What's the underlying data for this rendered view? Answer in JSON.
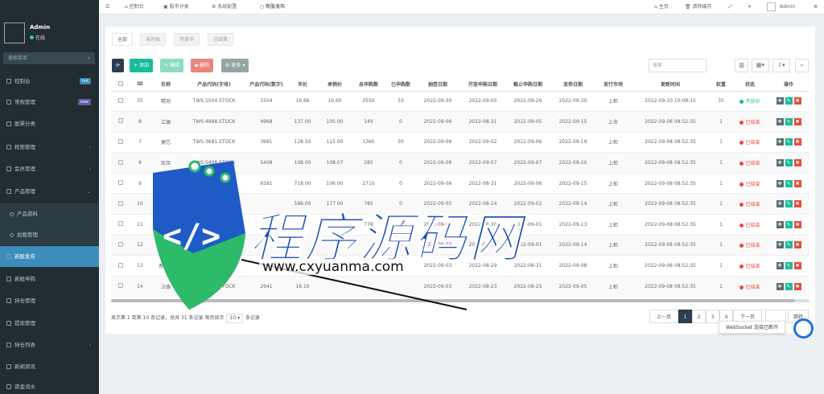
{
  "user": {
    "name": "Admin",
    "status": "在线"
  },
  "sidebar": {
    "search_placeholder": "搜索菜单",
    "items": [
      {
        "label": "控制台",
        "badge": "hot",
        "badge_color": "#3c8dbc"
      },
      {
        "label": "常规管理",
        "badge": "new",
        "badge_color": "#605ca8"
      },
      {
        "label": "股票分类",
        "badge": ""
      },
      {
        "label": "权限管理",
        "badge": ""
      },
      {
        "label": "会员管理",
        "badge": ""
      },
      {
        "label": "产品管理",
        "badge": ""
      },
      {
        "label": "产品资料",
        "badge": ""
      },
      {
        "label": "加载管理",
        "badge": ""
      },
      {
        "label": "新股发布",
        "badge": ""
      },
      {
        "label": "新股申购",
        "badge": ""
      },
      {
        "label": "持仓管理",
        "badge": ""
      },
      {
        "label": "提现管理",
        "badge": ""
      },
      {
        "label": "持仓列表",
        "badge": ""
      },
      {
        "label": "新闻资讯",
        "badge": ""
      },
      {
        "label": "资金流水",
        "badge": ""
      }
    ]
  },
  "topbar": {
    "tabs": [
      "控制台",
      "股市分类",
      "系统配置",
      "新股发布"
    ],
    "home": "主页",
    "clear": "清除缓存",
    "admin": "Admin"
  },
  "subtabs": [
    "全部",
    "未开始",
    "开放中",
    "已结束"
  ],
  "toolbar": {
    "refresh": "",
    "add": "添加",
    "edit": "编辑",
    "del": "删除",
    "more": "更多",
    "search": "搜索"
  },
  "colors": {
    "add": "#18bc9c",
    "edit": "#8bdcc2",
    "del": "#e8867a",
    "more": "#95a5a6",
    "refresh": "#2c3e50",
    "onsale": "#18bc9c",
    "ended": "#e74c3c",
    "open": "#18bc9c",
    "sidebar": "#222d32",
    "active": "#3c8dbc"
  },
  "table": {
    "headers": [
      "",
      "ID",
      "名称",
      "产品代码(字母)",
      "产品代码(数字)",
      "市价",
      "承销价",
      "总申购数",
      "已申购数",
      "抽签日期",
      "开放申购日期",
      "截止申购日期",
      "发券日期",
      "发行市场",
      "更新时间",
      "权重",
      "状态",
      "操作"
    ],
    "rows": [
      [
        "35",
        "精测",
        "TWS:1504.STOCK",
        "1504",
        "16.66",
        "16.60",
        "2550",
        "33",
        "2022-09-30",
        "2022-09-05",
        "2022-09-26",
        "2022-09-30",
        "上柜",
        "2022-09-10 10:08:15",
        "35",
        "开放中"
      ],
      [
        "8",
        "立镧",
        "TWS:4968.STOCK",
        "4968",
        "137.00",
        "105.00",
        "149",
        "0",
        "2022-09-06",
        "2022-08-31",
        "2022-09-05",
        "2022-09-15",
        "上市",
        "2022-09-08 08:52:35",
        "1",
        "已结束"
      ],
      [
        "7",
        "捷芯",
        "TWS:3681.STOCK",
        "3681",
        "128.50",
        "115.00",
        "1360",
        "30",
        "2022-09-08",
        "2022-09-02",
        "2022-09-06",
        "2022-09-19",
        "上柜",
        "2022-09-08 08:52:35",
        "1",
        "已结束"
      ],
      [
        "6",
        "凯钜",
        "TWS:5408.STOCK",
        "5408",
        "108.00",
        "108.07",
        "285",
        "0",
        "2022-09-08",
        "2022-09-07",
        "2022-09-07",
        "2022-09-20",
        "上柜",
        "2022-09-08 08:52:35",
        "1",
        "已结束"
      ],
      [
        "9",
        "宝",
        "TWS:6581.STOCK",
        "6581",
        "718.00",
        "106.00",
        "2710",
        "0",
        "2022-09-06",
        "2022-08-31",
        "2022-09-06",
        "2022-09-15",
        "上柜",
        "2022-09-08 08:52:35",
        "1",
        "已结束"
      ],
      [
        "10",
        "",
        "TWS:.STOCK",
        "",
        "588.00",
        "177.00",
        "785",
        "0",
        "2022-09-05",
        "2022-08-14",
        "2022-09-02",
        "2022-09-14",
        "上柜",
        "2022-09-08 08:52:35",
        "1",
        "已结束"
      ],
      [
        "11",
        "",
        "TWS:.STOCK",
        "",
        "",
        "",
        "778",
        "0",
        "2022-09-05",
        "2022-08-30",
        "2022-09-01",
        "2022-09-13",
        "上柜",
        "2022-09-08 08:52:35",
        "1",
        "已结束"
      ],
      [
        "12",
        "",
        "TWS:6667.STOCK",
        "",
        "",
        "",
        "",
        "0",
        "2022-09-03",
        "2022-08-30",
        "2022-09-01",
        "2022-09-14",
        "上柜",
        "2022-09-08 08:52:35",
        "1",
        "已结束"
      ],
      [
        "13",
        "者钛科",
        "TWS:3436.STOCK",
        "",
        "",
        "",
        "",
        "0",
        "2022-09-03",
        "2022-08-29",
        "2022-08-31",
        "2022-09-08",
        "上柜",
        "2022-09-08 08:52:35",
        "1",
        "已结束"
      ],
      [
        "14",
        "汪德",
        "TWS:2641.STOCK",
        "2641",
        "16.10",
        "",
        "",
        "",
        "2022-09-03",
        "2022-08-23",
        "2022-08-25",
        "2022-09-05",
        "上柜",
        "2022-09-08 08:52:35",
        "1",
        "已结束"
      ]
    ]
  },
  "pagination": {
    "info_a": "显示第 1 到第 10 条记录，总共 31 条记录 每页显示",
    "size": "10",
    "info_b": "条记录",
    "prev": "上一页",
    "pages": [
      "1",
      "2",
      "3",
      "4"
    ],
    "next": "下一页",
    "jump": "跳转"
  },
  "toast": "WebSocket 连接已断开",
  "watermark": {
    "title": "程序源码网",
    "url": "www.cxyuanma.com"
  }
}
